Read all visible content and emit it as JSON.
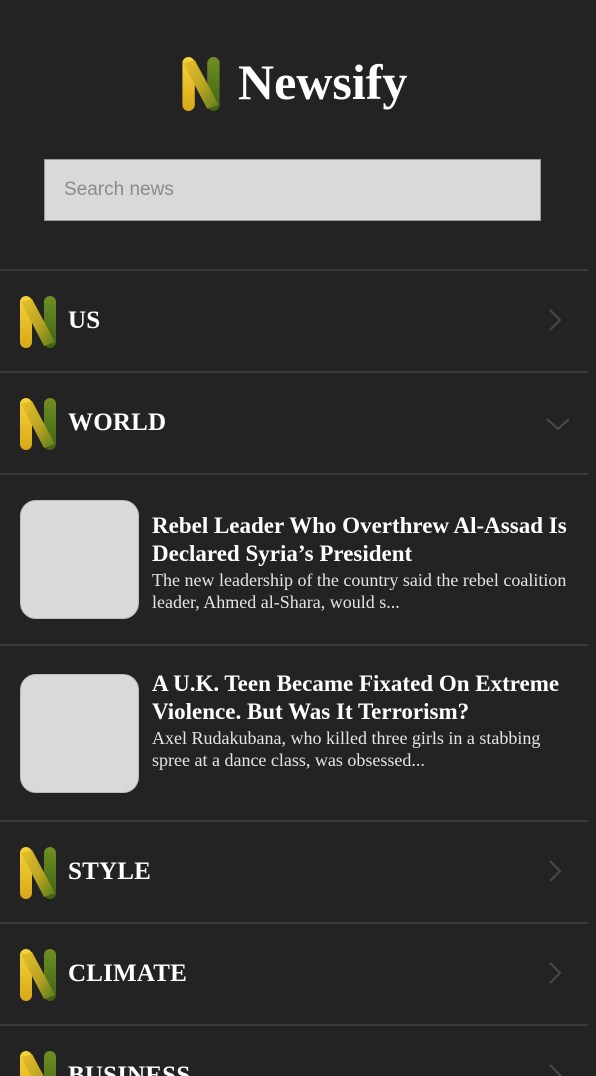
{
  "app": {
    "title": "Newsify"
  },
  "search": {
    "placeholder": "Search news",
    "value": ""
  },
  "categories": [
    {
      "label": "US",
      "expanded": false,
      "icon": "chevron-right-icon"
    },
    {
      "label": "WORLD",
      "expanded": true,
      "icon": "chevron-down-icon"
    },
    {
      "label": "STYLE",
      "expanded": false,
      "icon": "chevron-right-icon"
    },
    {
      "label": "CLIMATE",
      "expanded": false,
      "icon": "chevron-right-icon"
    },
    {
      "label": "BUSINESS",
      "expanded": false,
      "icon": "chevron-right-icon"
    }
  ],
  "world_articles": [
    {
      "title": "Rebel Leader Who Overthrew Al-Assad Is Declared Syria’s President",
      "description": "The new leadership of the country said the rebel coalition leader, Ahmed al-Shara, would s..."
    },
    {
      "title": "A U.K. Teen Became Fixated On Extreme Violence. But Was It Terrorism?",
      "description": "Axel Rudakubana, who killed three girls in a stabbing spree at a dance class, was obsessed..."
    }
  ],
  "colors": {
    "background": "#232323",
    "divider": "#3b3b3b",
    "search_bg": "#d9d9d9",
    "thumb_bg": "#d9d9d9",
    "logo_yellow": "#f2c521",
    "logo_green": "#5c7d1e",
    "chevron": "#4a4a4a",
    "text": "#ffffff"
  },
  "icons": {
    "logo": "newsify-n-logo-icon"
  }
}
